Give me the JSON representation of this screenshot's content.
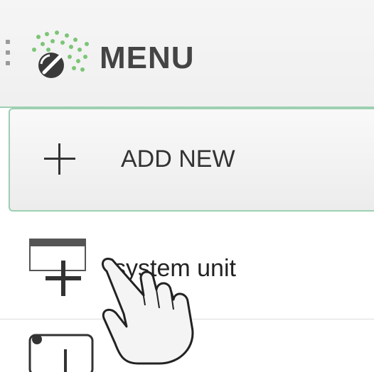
{
  "header": {
    "title": "MENU",
    "border_color": "#9ccfb1",
    "drag_icon": "drag-handle-icon",
    "logo_icon": "app-logo-icon"
  },
  "add_new": {
    "label": "ADD NEW",
    "icon": "plus-icon"
  },
  "items": [
    {
      "label": "system unit",
      "icon": "system-unit-icon"
    },
    {
      "label": "",
      "icon": "rack-unit-icon"
    }
  ],
  "pointer": {
    "icon": "hand-pointer-icon"
  }
}
